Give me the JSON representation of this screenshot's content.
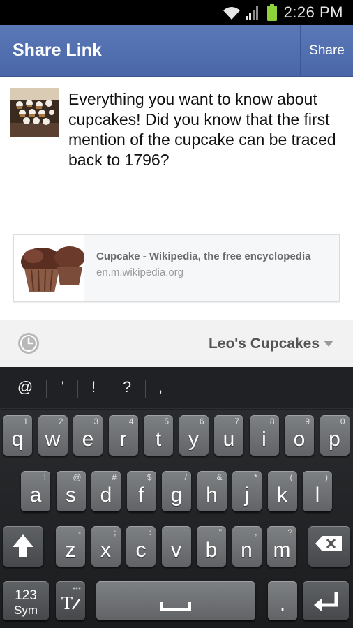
{
  "status_bar": {
    "time": "2:26 PM"
  },
  "header": {
    "title": "Share Link",
    "share_label": "Share"
  },
  "post": {
    "text": "Everything you want to know about cupcakes! Did you know that the first mention of the cupcake can be traced back to 1796?"
  },
  "link_card": {
    "title": "Cupcake - Wikipedia, the free encyclopedia",
    "url": "en.m.wikipedia.org"
  },
  "selector": {
    "page_name": "Leo's Cupcakes"
  },
  "keyboard": {
    "suggestions": [
      "@",
      "'",
      "!",
      "?",
      ","
    ],
    "row1": [
      {
        "k": "q",
        "h": "1"
      },
      {
        "k": "w",
        "h": "2"
      },
      {
        "k": "e",
        "h": "3"
      },
      {
        "k": "r",
        "h": "4"
      },
      {
        "k": "t",
        "h": "5"
      },
      {
        "k": "y",
        "h": "6"
      },
      {
        "k": "u",
        "h": "7"
      },
      {
        "k": "i",
        "h": "8"
      },
      {
        "k": "o",
        "h": "9"
      },
      {
        "k": "p",
        "h": "0"
      }
    ],
    "row2": [
      {
        "k": "a",
        "h": "!"
      },
      {
        "k": "s",
        "h": "@"
      },
      {
        "k": "d",
        "h": "#"
      },
      {
        "k": "f",
        "h": "$"
      },
      {
        "k": "g",
        "h": "/"
      },
      {
        "k": "h",
        "h": "&"
      },
      {
        "k": "j",
        "h": "*"
      },
      {
        "k": "k",
        "h": "("
      },
      {
        "k": "l",
        "h": ")"
      }
    ],
    "row3": [
      {
        "k": "z",
        "h": "-"
      },
      {
        "k": "x",
        "h": ";"
      },
      {
        "k": "c",
        "h": ":"
      },
      {
        "k": "v",
        "h": "'"
      },
      {
        "k": "b",
        "h": "\""
      },
      {
        "k": "n",
        "h": ","
      },
      {
        "k": "m",
        "h": "?"
      }
    ],
    "sym_label_top": "123",
    "sym_label_bottom": "Sym",
    "period": "."
  },
  "icons": {
    "wifi": "wifi-icon",
    "signal": "signal-icon",
    "battery": "battery-icon",
    "clock": "clock-icon",
    "shift": "shift-icon",
    "backspace": "backspace-icon",
    "text_mode": "text-mode-icon",
    "space": "space-icon",
    "enter": "enter-icon"
  },
  "colors": {
    "header_blue": "#4a66a6",
    "battery_green": "#8fd13a"
  }
}
